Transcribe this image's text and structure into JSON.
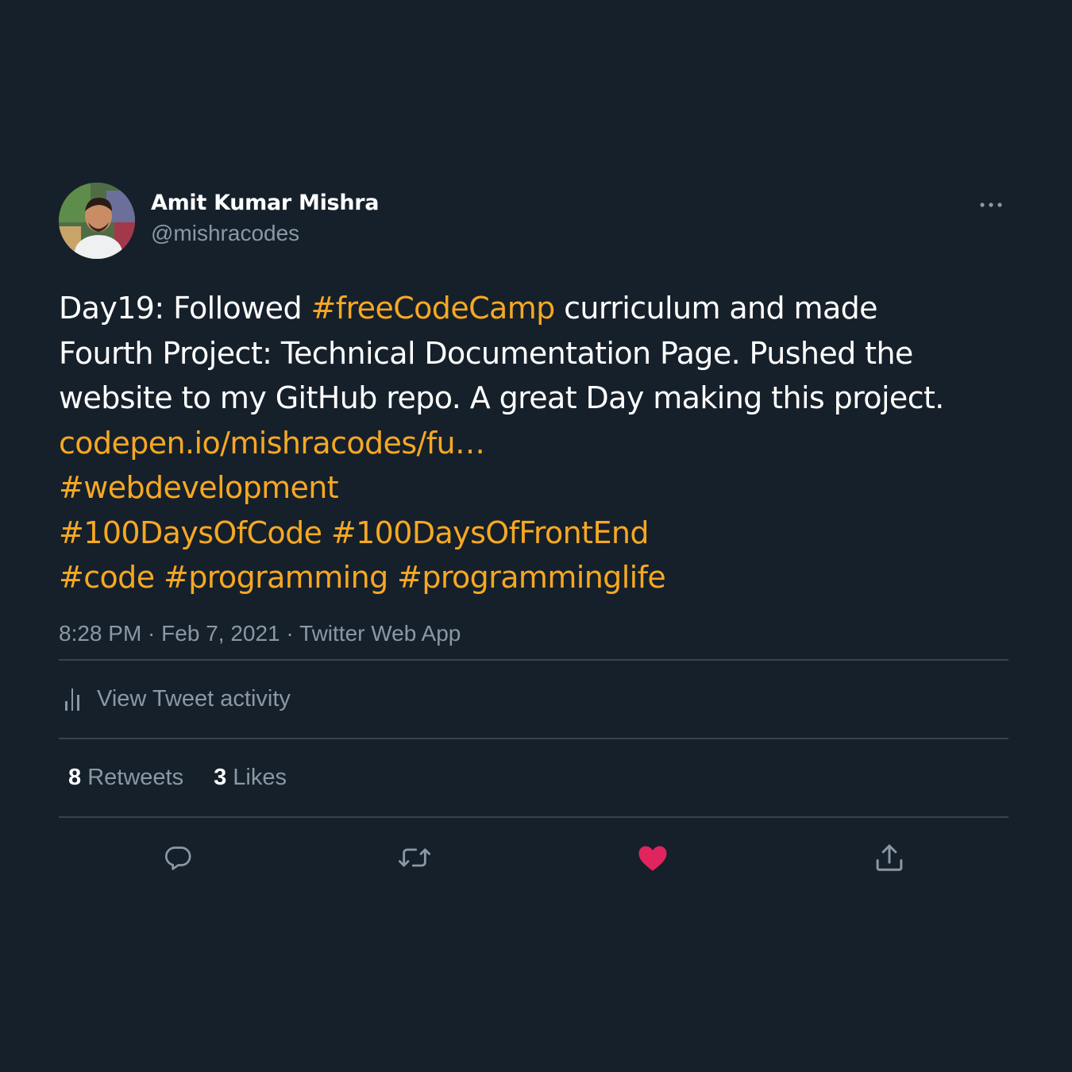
{
  "author": {
    "display_name": "Amit Kumar Mishra",
    "handle": "@mishracodes"
  },
  "tweet": {
    "lines": [
      [
        {
          "text": "Day19: Followed ",
          "kind": "text"
        },
        {
          "text": "#freeCodeCamp",
          "kind": "link"
        },
        {
          "text": " curriculum and made",
          "kind": "text"
        }
      ],
      [
        {
          "text": "Fourth Project: Technical Documentation Page. Pushed the",
          "kind": "text"
        }
      ],
      [
        {
          "text": "website to my GitHub repo. A great Day making this project.",
          "kind": "text"
        }
      ],
      [
        {
          "text": "codepen.io/mishracodes/fu…",
          "kind": "link"
        }
      ],
      [
        {
          "text": "#webdevelopment",
          "kind": "link"
        }
      ],
      [
        {
          "text": "#100DaysOfCode",
          "kind": "link"
        },
        {
          "text": " ",
          "kind": "text"
        },
        {
          "text": "#100DaysOfFrontEnd",
          "kind": "link"
        }
      ],
      [
        {
          "text": "#code",
          "kind": "link"
        },
        {
          "text": " ",
          "kind": "text"
        },
        {
          "text": "#programming",
          "kind": "link"
        },
        {
          "text": " ",
          "kind": "text"
        },
        {
          "text": "#programminglife",
          "kind": "link"
        }
      ]
    ],
    "time": "8:28 PM",
    "separator": " · ",
    "date": "Feb 7, 2021",
    "source": "Twitter Web App"
  },
  "activity": {
    "label": "View Tweet activity"
  },
  "stats": {
    "retweets_count": "8",
    "retweets_label": "Retweets",
    "likes_count": "3",
    "likes_label": "Likes"
  },
  "icons": {
    "more": "more-horizontal-icon",
    "activity": "bar-chart-icon",
    "reply": "reply-icon",
    "retweet": "retweet-icon",
    "like": "heart-filled-icon",
    "share": "share-icon"
  },
  "colors": {
    "background": "#16202a",
    "accent_link": "#f6a823",
    "muted_text": "#8b98a5",
    "divider": "#38444d",
    "like_active": "#e0245e"
  }
}
